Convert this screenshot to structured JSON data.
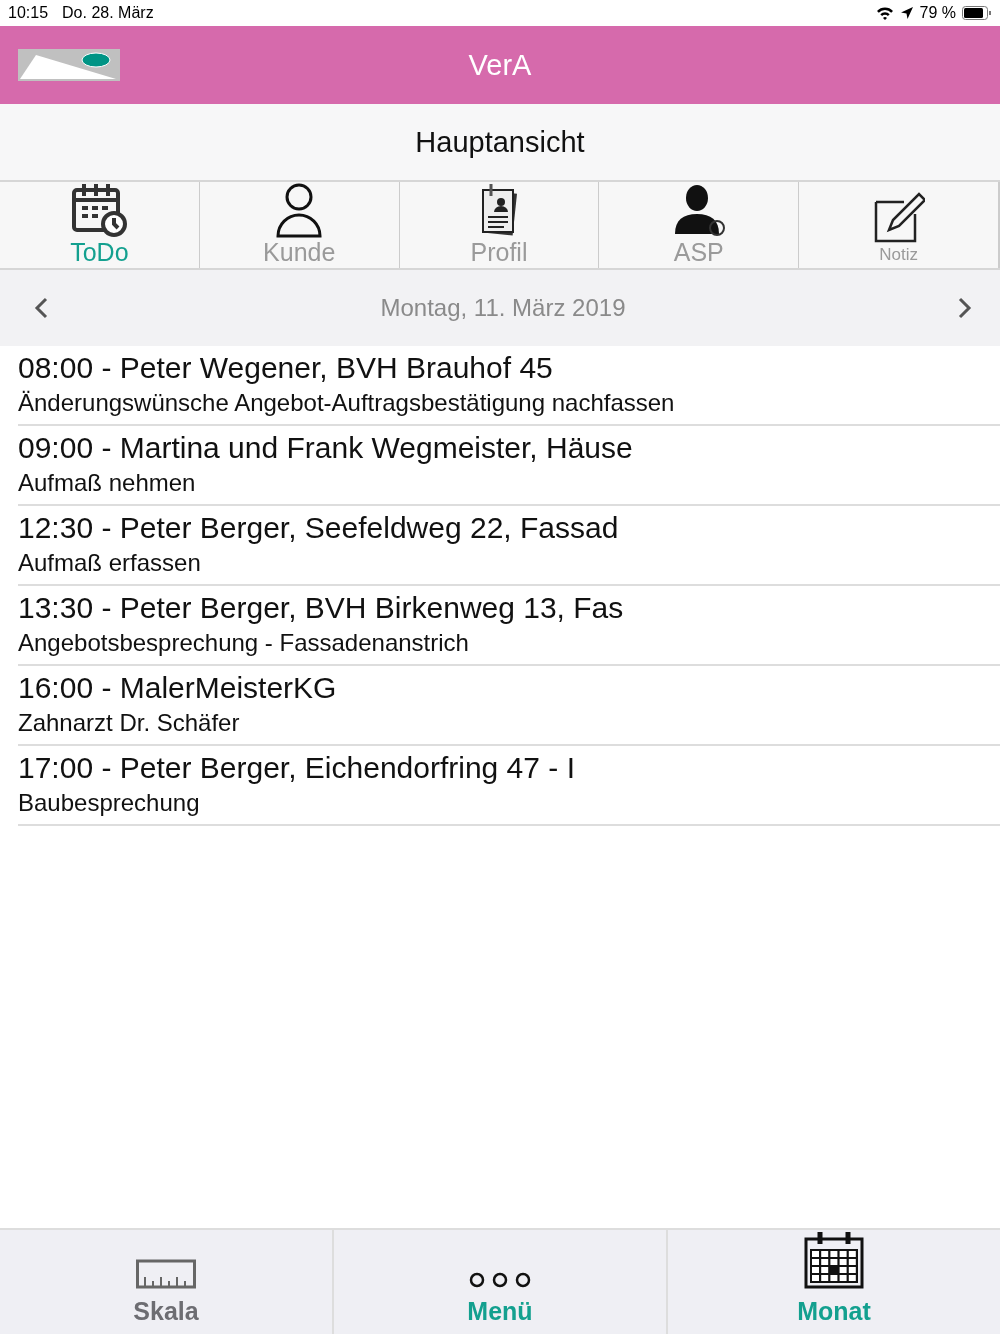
{
  "status_bar": {
    "time": "10:15",
    "date": "Do. 28. März",
    "battery": "79 %"
  },
  "header": {
    "title": "VerA"
  },
  "title_bar": {
    "title": "Hauptansicht"
  },
  "tabs": [
    {
      "label": "ToDo",
      "selected": true,
      "kind": "standard"
    },
    {
      "label": "Kunde",
      "selected": false,
      "kind": "standard"
    },
    {
      "label": "Profil",
      "selected": false,
      "kind": "standard"
    },
    {
      "label": "ASP",
      "selected": false,
      "kind": "standard"
    },
    {
      "label": "Notiz",
      "selected": false,
      "kind": "compact"
    }
  ],
  "date_nav": {
    "date": "Montag, 11. März 2019"
  },
  "appointments": [
    {
      "title": "08:00 - Peter Wegener, BVH Brauhof 45",
      "subtitle": "Änderungswünsche Angebot-Auftragsbestätigung nachfassen"
    },
    {
      "title": "09:00 - Martina und Frank Wegmeister, Häuse",
      "subtitle": "Aufmaß nehmen"
    },
    {
      "title": "12:30 - Peter Berger, Seefeldweg 22, Fassad",
      "subtitle": "Aufmaß erfassen"
    },
    {
      "title": "13:30 - Peter Berger, BVH Birkenweg 13, Fas",
      "subtitle": "Angebotsbesprechung - Fassadenanstrich"
    },
    {
      "title": "16:00 - MalerMeisterKG",
      "subtitle": "Zahnarzt Dr. Schäfer"
    },
    {
      "title": "17:00 - Peter Berger, Eichendorfring 47 - I",
      "subtitle": "Baubesprechung"
    }
  ],
  "bottom_bar": [
    {
      "label": "Skala",
      "selected": false
    },
    {
      "label": "Menü",
      "selected": true
    },
    {
      "label": "Monat",
      "selected": true
    }
  ]
}
